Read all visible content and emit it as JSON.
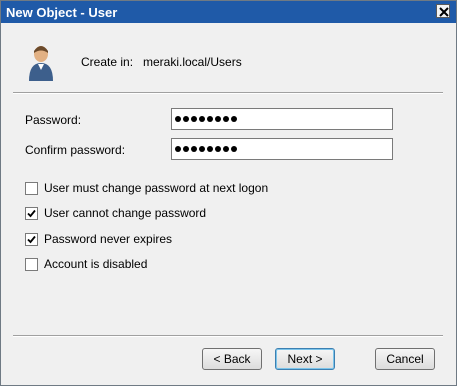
{
  "window": {
    "title": "New Object - User",
    "close_icon": "close-icon"
  },
  "header": {
    "create_in_label": "Create in:",
    "create_in_path": "meraki.local/Users",
    "icon": "user-icon"
  },
  "fields": {
    "password_label": "Password:",
    "password_dots": 8,
    "confirm_label": "Confirm password:",
    "confirm_dots": 8
  },
  "options": [
    {
      "label": "User must change password at next logon",
      "checked": false
    },
    {
      "label": "User cannot change password",
      "checked": true
    },
    {
      "label": "Password never expires",
      "checked": true
    },
    {
      "label": "Account is disabled",
      "checked": false
    }
  ],
  "buttons": {
    "back": "< Back",
    "next": "Next >",
    "cancel": "Cancel"
  }
}
